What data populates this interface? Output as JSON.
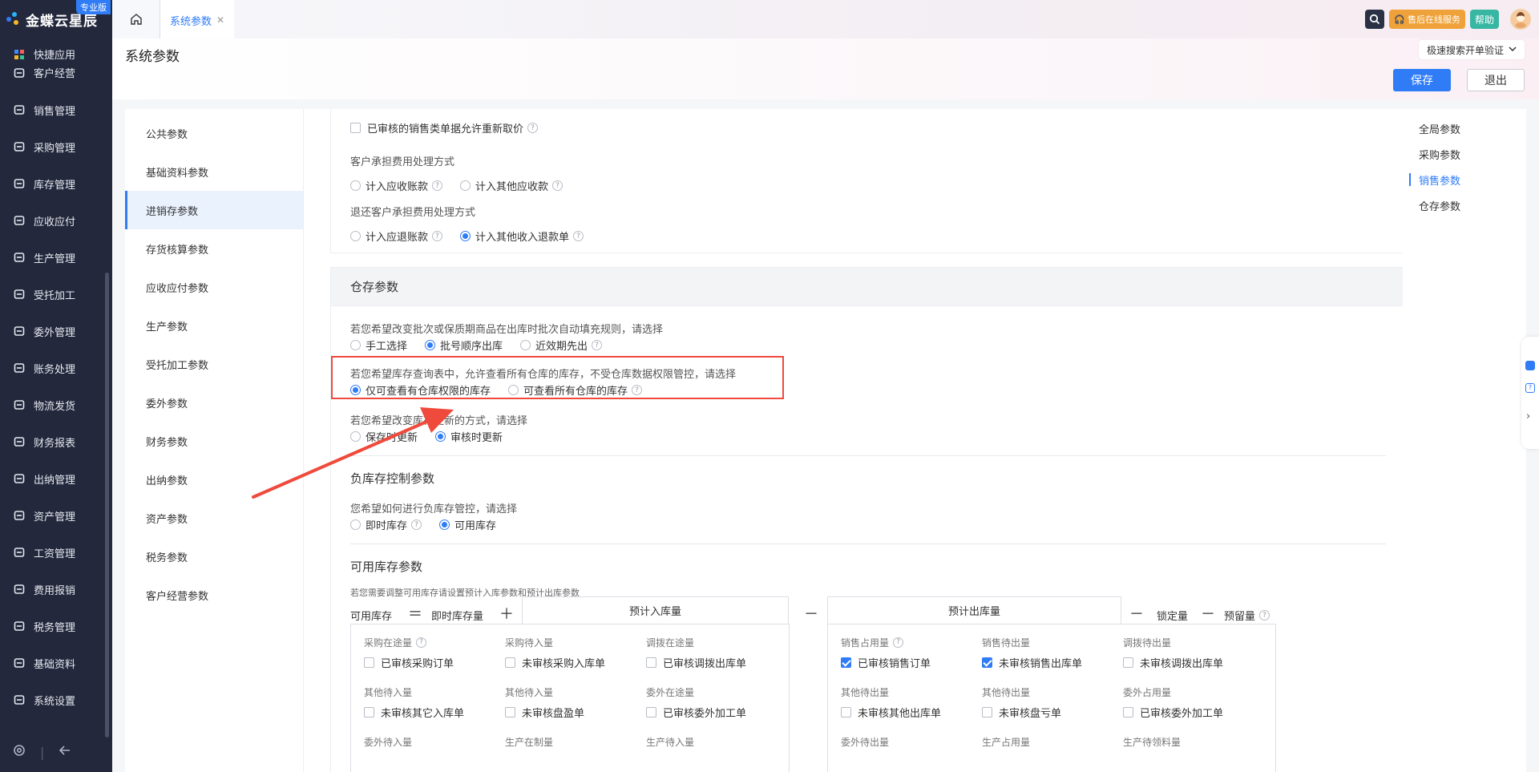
{
  "brand": {
    "name": "金蝶云星辰",
    "edition": "专业版"
  },
  "nav": {
    "items": [
      {
        "label": "快捷应用",
        "icon": "grid-icon"
      },
      {
        "label": "客户经营",
        "icon": "user-icon"
      },
      {
        "label": "销售管理",
        "icon": "sales-chart-icon"
      },
      {
        "label": "采购管理",
        "icon": "cart-icon"
      },
      {
        "label": "库存管理",
        "icon": "box-icon"
      },
      {
        "label": "应收应付",
        "icon": "diamond-icon"
      },
      {
        "label": "生产管理",
        "icon": "factory-icon"
      },
      {
        "label": "受托加工",
        "icon": "tools-icon"
      },
      {
        "label": "委外管理",
        "icon": "outsource-icon"
      },
      {
        "label": "账务处理",
        "icon": "ledger-icon"
      },
      {
        "label": "物流发货",
        "icon": "truck-icon"
      },
      {
        "label": "财务报表",
        "icon": "report-icon"
      },
      {
        "label": "出纳管理",
        "icon": "cashier-icon"
      },
      {
        "label": "资产管理",
        "icon": "asset-icon"
      },
      {
        "label": "工资管理",
        "icon": "salary-icon"
      },
      {
        "label": "费用报销",
        "icon": "expense-icon"
      },
      {
        "label": "税务管理",
        "icon": "tax-icon"
      },
      {
        "label": "基础资料",
        "icon": "layers-icon"
      },
      {
        "label": "系统设置",
        "icon": "settings-hex-icon"
      }
    ]
  },
  "tabs": {
    "active": "系统参数"
  },
  "topbar": {
    "service": "售后在线服务",
    "help": "帮助"
  },
  "header": {
    "title": "系统参数",
    "quick_search": "极速搜索开单验证",
    "save": "保存",
    "exit": "退出"
  },
  "subnav": {
    "items": [
      "公共参数",
      "基础资料参数",
      "进销存参数",
      "存货核算参数",
      "应收应付参数",
      "生产参数",
      "受托加工参数",
      "委外参数",
      "财务参数",
      "出纳参数",
      "资产参数",
      "税务参数",
      "客户经营参数"
    ],
    "active_index": 2
  },
  "anchors": {
    "items": [
      "全局参数",
      "采购参数",
      "销售参数",
      "仓存参数"
    ],
    "active_index": 2
  },
  "sales": {
    "reprice": "已审核的销售类单据允许重新取价",
    "cust_fee_label": "客户承担费用处理方式",
    "cust_fee_opt1": "计入应收账款",
    "cust_fee_opt2": "计入其他应收款",
    "return_fee_label": "退还客户承担费用处理方式",
    "return_fee_opt1": "计入应退账款",
    "return_fee_opt2": "计入其他收入退款单"
  },
  "warehouse": {
    "title": "仓存参数",
    "batch_label": "若您希望改变批次或保质期商品在出库时批次自动填充规则，请选择",
    "batch_opt1": "手工选择",
    "batch_opt2": "批号顺序出库",
    "batch_opt3": "近效期先出",
    "query_label": "若您希望库存查询表中，允许查看所有仓库的库存，不受仓库数据权限管控，请选择",
    "query_opt1": "仅可查看有仓库权限的库存",
    "query_opt2": "可查看所有仓库的库存",
    "update_label": "若您希望改变库存更新的方式，请选择",
    "update_opt1": "保存时更新",
    "update_opt2": "审核时更新"
  },
  "negative": {
    "title": "负库存控制参数",
    "label": "您希望如何进行负库存管控，请选择",
    "opt1": "即时库存",
    "opt2": "可用库存"
  },
  "available": {
    "title": "可用库存参数",
    "hint": "若您需要调整可用库存请设置预计入库参数和预计出库参数",
    "formula": {
      "available": "可用库存",
      "eq": "＝",
      "instant": "即时库存量",
      "plus": "＋",
      "expected_in": "预计入库量",
      "minus": "－",
      "expected_out": "预计出库量",
      "minus2": "－",
      "locked": "锁定量",
      "minus3": "－",
      "reserved": "预留量"
    },
    "in_cells": [
      {
        "title": "采购在途量",
        "label": "已审核采购订单",
        "checked": false,
        "help": true
      },
      {
        "title": "采购待入量",
        "label": "未审核采购入库单",
        "checked": false,
        "help": false
      },
      {
        "title": "调拨在途量",
        "label": "已审核调拨出库单",
        "checked": false,
        "help": false
      },
      {
        "title": "其他待入量",
        "label": "未审核其它入库单",
        "checked": false,
        "help": false
      },
      {
        "title": "其他待入量",
        "label": "未审核盘盈单",
        "checked": false,
        "help": false
      },
      {
        "title": "委外在途量",
        "label": "已审核委外加工单",
        "checked": false,
        "help": false
      },
      {
        "title": "委外待入量",
        "label": "",
        "checked": false,
        "help": false
      },
      {
        "title": "生产在制量",
        "label": "",
        "checked": false,
        "help": false
      },
      {
        "title": "生产待入量",
        "label": "",
        "checked": false,
        "help": false
      }
    ],
    "out_cells": [
      {
        "title": "销售占用量",
        "label": "已审核销售订单",
        "checked": true,
        "help": true
      },
      {
        "title": "销售待出量",
        "label": "未审核销售出库单",
        "checked": true,
        "help": false
      },
      {
        "title": "调拨待出量",
        "label": "未审核调拨出库单",
        "checked": false,
        "help": false
      },
      {
        "title": "其他待出量",
        "label": "未审核其他出库单",
        "checked": false,
        "help": false
      },
      {
        "title": "其他待出量",
        "label": "未审核盘亏单",
        "checked": false,
        "help": false
      },
      {
        "title": "委外占用量",
        "label": "已审核委外加工单",
        "checked": false,
        "help": false
      },
      {
        "title": "委外待出量",
        "label": "",
        "checked": false,
        "help": false
      },
      {
        "title": "生产占用量",
        "label": "",
        "checked": false,
        "help": false
      },
      {
        "title": "生产待领料量",
        "label": "",
        "checked": false,
        "help": false
      }
    ]
  },
  "colors": {
    "primary": "#2f7cf6",
    "nav_bg": "#23283c",
    "highlight": "#ef4a3c",
    "arrow": "#ef4a3c"
  }
}
